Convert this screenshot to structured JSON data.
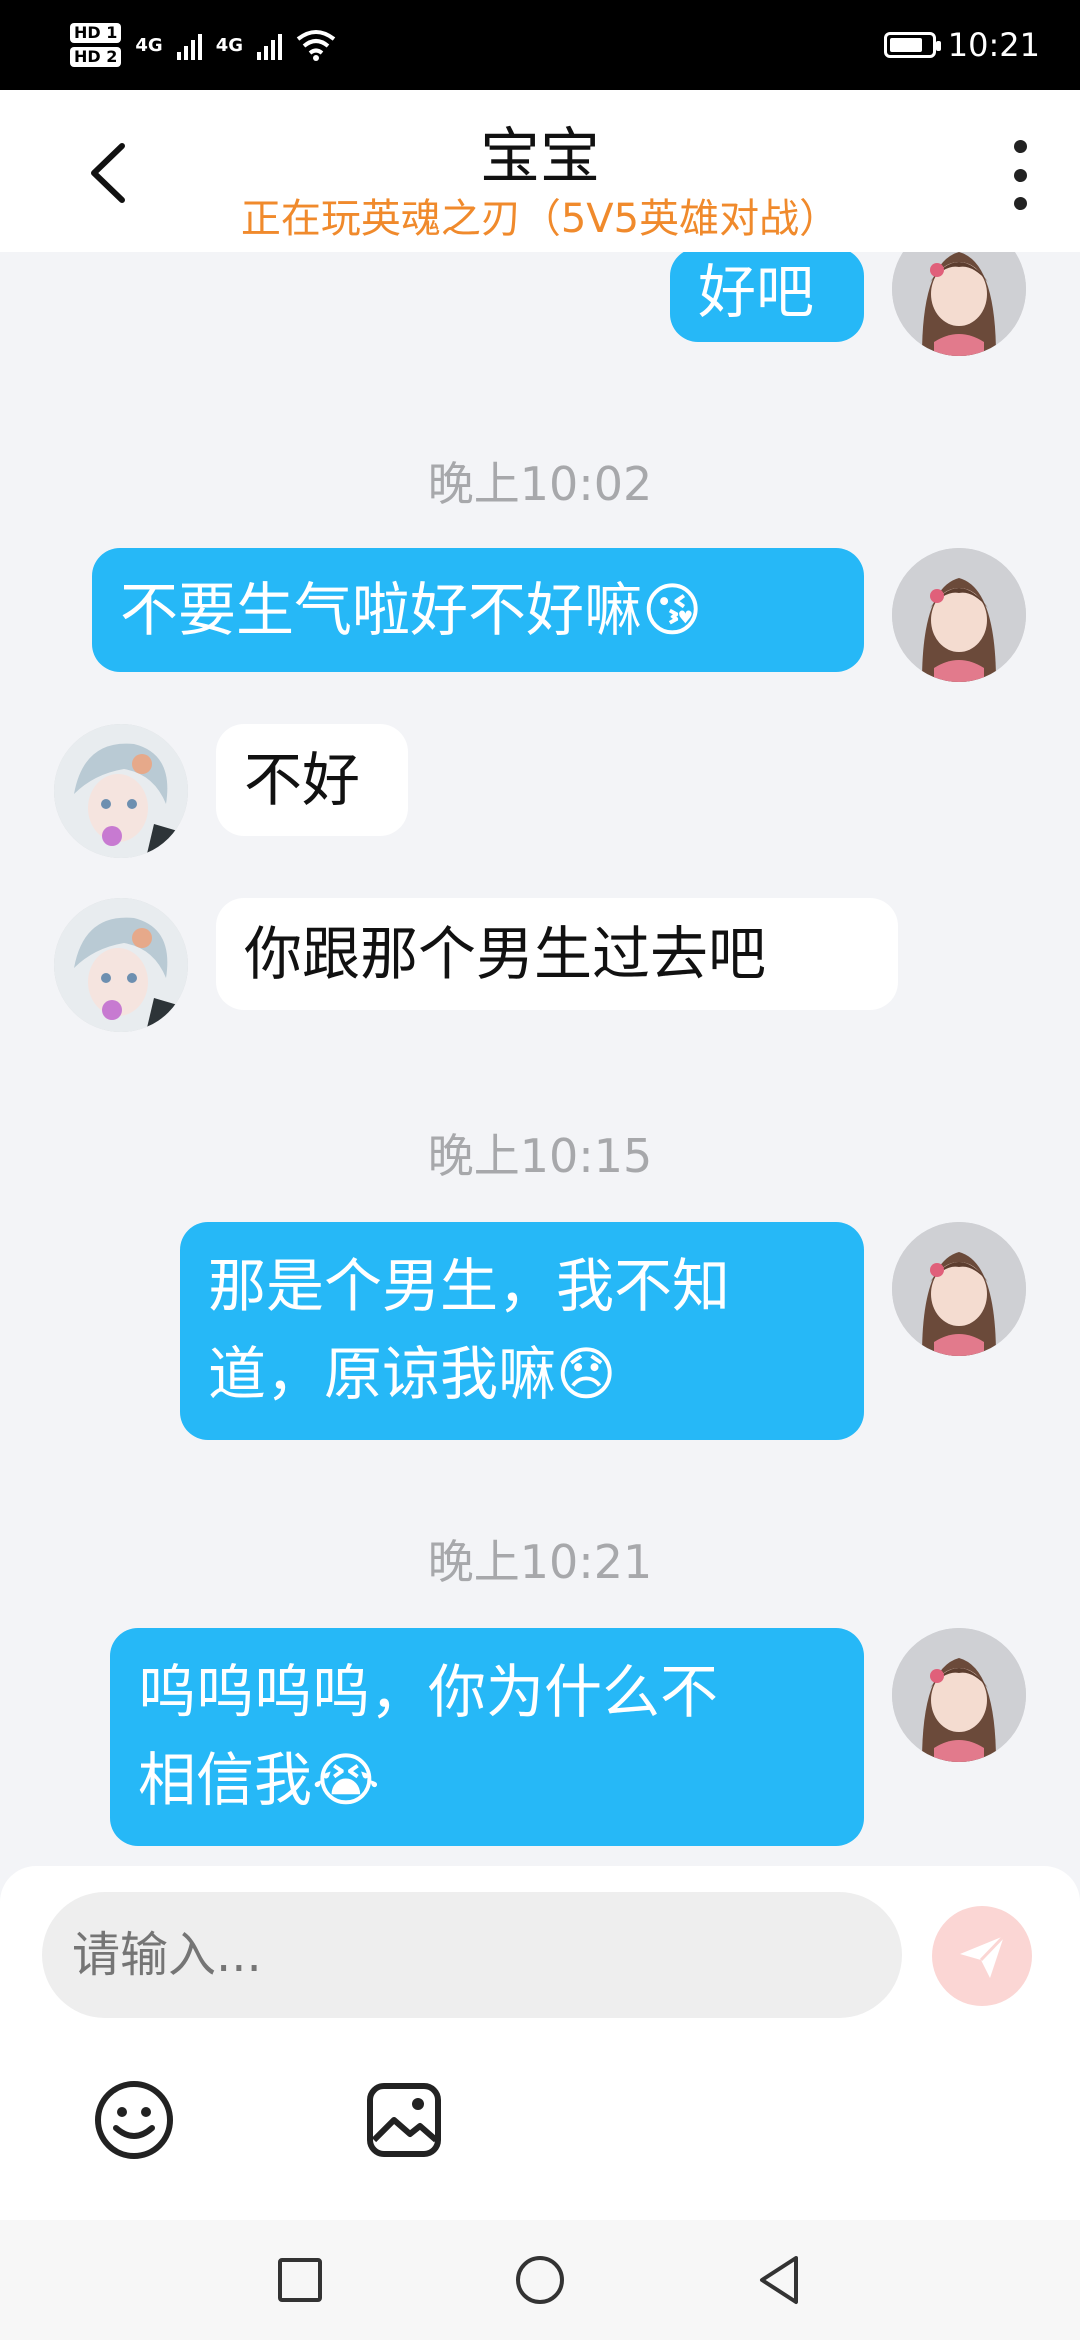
{
  "status_bar": {
    "hd1": "HD 1",
    "hd2": "HD 2",
    "net1": "4G",
    "net2": "4G",
    "time": "10:21",
    "icons": [
      "signal-icon",
      "wifi-icon",
      "battery-icon"
    ]
  },
  "header": {
    "title": "宝宝",
    "subtitle": "正在玩英魂之刃（5V5英雄对战）",
    "icons": [
      "back-arrow-icon",
      "more-vertical-icon"
    ]
  },
  "messages": [
    {
      "side": "out",
      "text": "好吧"
    },
    {
      "type": "time",
      "text": "晚上10:02"
    },
    {
      "side": "out",
      "text": "不要生气啦好不好嘛😘"
    },
    {
      "side": "in",
      "text": "不好"
    },
    {
      "side": "in",
      "text": "你跟那个男生过去吧"
    },
    {
      "type": "time",
      "text": "晚上10:15"
    },
    {
      "side": "out",
      "line1": "那是个男生，我不知",
      "line2": "道，原谅我嘛😞"
    },
    {
      "type": "time",
      "text": "晚上10:21"
    },
    {
      "side": "out",
      "line1": "呜呜呜呜，你为什么不",
      "line2": "相信我😭"
    }
  ],
  "composer": {
    "placeholder": "请输入...",
    "icons": [
      "send-icon",
      "emoji-icon",
      "image-icon"
    ]
  },
  "colors": {
    "accent_bubble": "#26b8f7",
    "subtitle_orange": "#f08a2c",
    "send_button": "#fbd6d4"
  },
  "nav_bar": {
    "icons": [
      "recent-apps-icon",
      "home-icon",
      "back-icon"
    ]
  }
}
